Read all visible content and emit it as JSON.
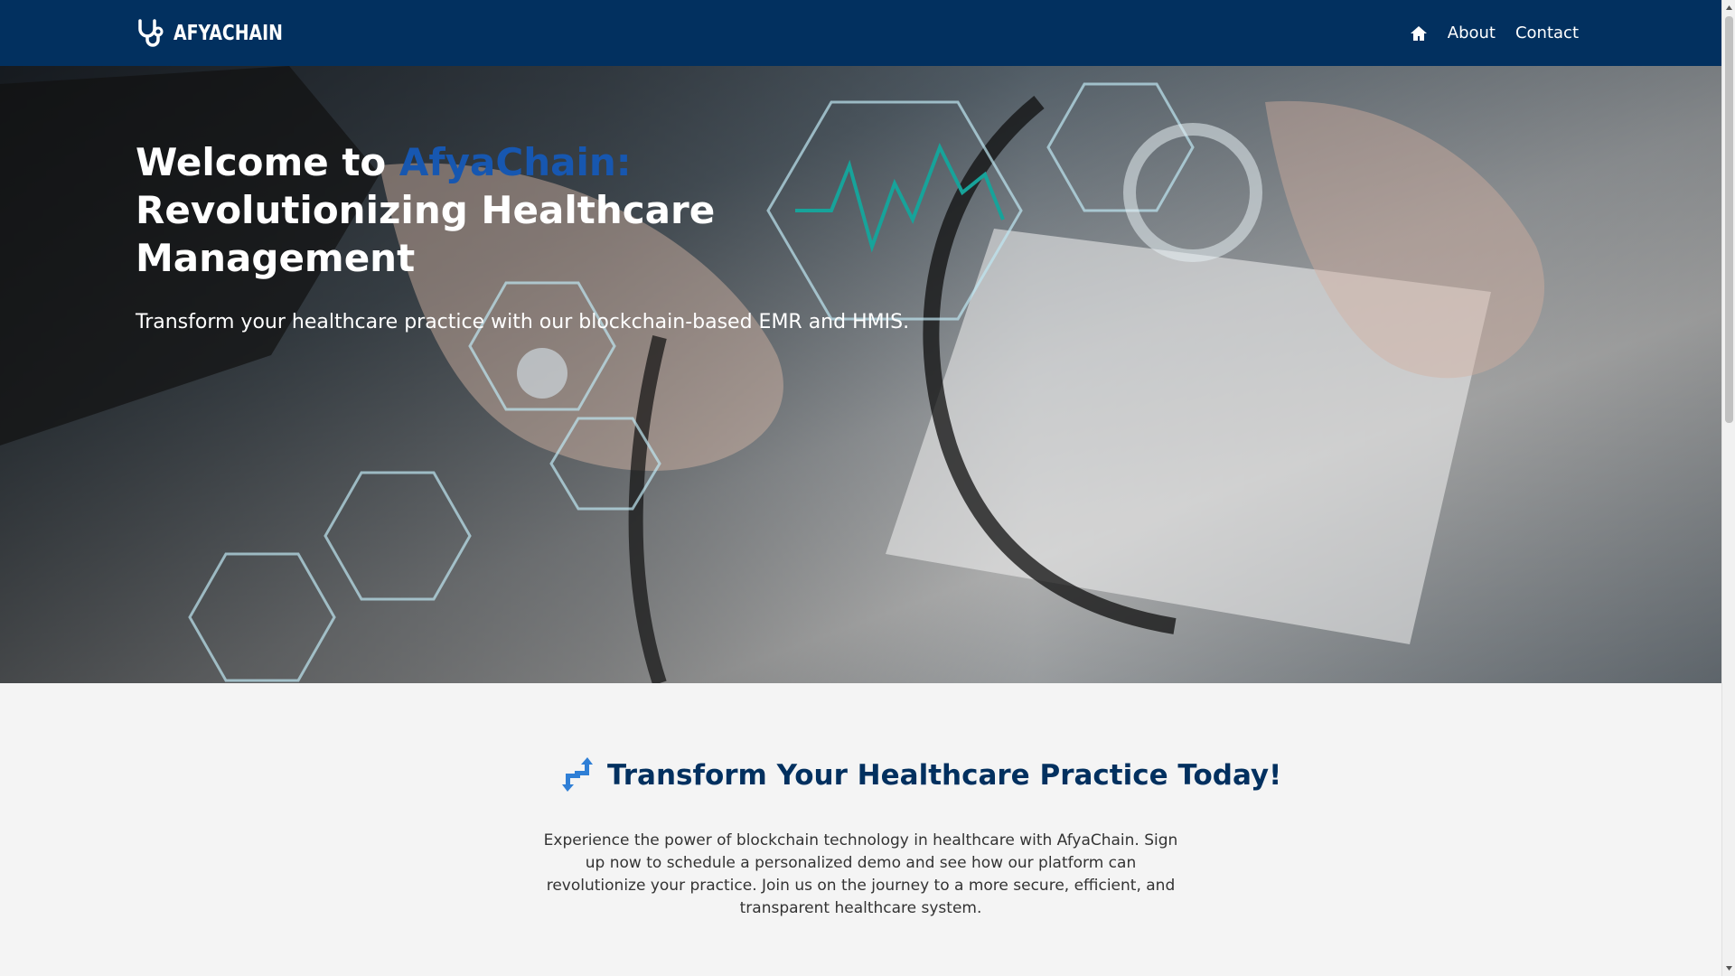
{
  "nav": {
    "brand": "AFYACHAIN",
    "links": {
      "about": "About",
      "contact": "Contact"
    }
  },
  "hero": {
    "title_prefix": "Welcome to ",
    "title_accent": "AfyaChain:",
    "title_rest": "Revolutionizing Healthcare Management",
    "subtitle": "Transform your healthcare practice with our blockchain-based EMR and HMIS."
  },
  "cta": {
    "title": "Transform Your Healthcare Practice Today!",
    "body": "Experience the power of blockchain technology in healthcare with AfyaChain. Sign up now to schedule a personalized demo and see how our platform can revolutionize your practice. Join us on the journey to a more secure, efficient, and transparent healthcare system."
  },
  "colors": {
    "navbar": "#02305f",
    "accent": "#1757b0",
    "heading": "#02305f",
    "icon": "#2f7fd6",
    "background": "#f4f4f4"
  },
  "icons": {
    "brand": "stethoscope-icon",
    "home": "home-icon",
    "cta": "arrows-exchange-icon"
  }
}
